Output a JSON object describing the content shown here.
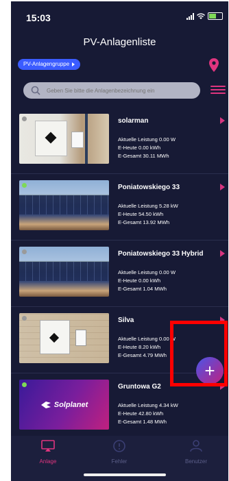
{
  "status": {
    "time": "15:03"
  },
  "header": {
    "title": "PV-Anlagenliste"
  },
  "group_button": {
    "label": "PV-Anlagengruppe"
  },
  "search": {
    "placeholder": "Geben Sie bitte die Anlagenbezeichnung ein"
  },
  "colors": {
    "accent": "#e0357f",
    "primary_blue": "#3b5cff",
    "background": "#171a35",
    "status_online": "#7ed957",
    "status_offline": "#9a9a9a"
  },
  "plants": [
    {
      "name": "solarman",
      "status": "offline",
      "power_label": "Aktuelle Leistung",
      "power": "0.00 W",
      "today_label": "E-Heute",
      "today": "0.00 kWh",
      "total_label": "E-Gesamt",
      "total": "30.11 MWh"
    },
    {
      "name": "Poniatowskiego 33",
      "status": "online",
      "power_label": "Aktuelle Leistung",
      "power": "5.28 kW",
      "today_label": "E-Heute",
      "today": "54.50 kWh",
      "total_label": "E-Gesamt",
      "total": "13.92 MWh"
    },
    {
      "name": "Poniatowskiego 33 Hybrid",
      "status": "offline",
      "power_label": "Aktuelle Leistung",
      "power": "0.00 W",
      "today_label": "E-Heute",
      "today": "0.00 kWh",
      "total_label": "E-Gesamt",
      "total": "1.04 MWh"
    },
    {
      "name": "Silva",
      "status": "offline",
      "power_label": "Aktuelle Leistung",
      "power": "0.00 W",
      "today_label": "E-Heute",
      "today": "8.20 kWh",
      "total_label": "E-Gesamt",
      "total": "4.79 MWh"
    },
    {
      "name": "Gruntowa G2",
      "status": "online",
      "power_label": "Aktuelle Leistung",
      "power": "4.34 kW",
      "today_label": "E-Heute",
      "today": "42.80 kWh",
      "total_label": "E-Gesamt",
      "total": "1.48 MWh",
      "logo_text": "Solplanet"
    }
  ],
  "fab": {
    "symbol": "+"
  },
  "nav": {
    "anlage": "Anlage",
    "fehler": "Fehler",
    "benutzer": "Benutzer"
  }
}
